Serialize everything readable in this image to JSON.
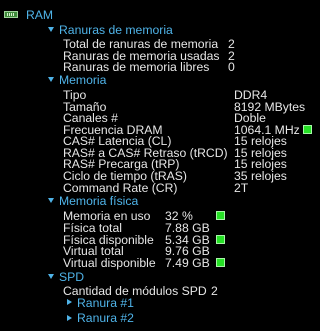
{
  "root": {
    "label": "RAM",
    "icon": "ram-chip-icon"
  },
  "sections": {
    "slots": {
      "title": "Ranuras de memoria",
      "rows": [
        {
          "label": "Total de ranuras de memoria",
          "value": "2"
        },
        {
          "label": "Ranuras de memoria usadas",
          "value": "2"
        },
        {
          "label": "Ranuras de memoria libres",
          "value": "0"
        }
      ]
    },
    "memory": {
      "title": "Memoria",
      "rows": [
        {
          "label": "Tipo",
          "value": "DDR4"
        },
        {
          "label": "Tamaño",
          "value": "8192 MBytes"
        },
        {
          "label": "Canales #",
          "value": "Doble"
        },
        {
          "label": "Frecuencia DRAM",
          "value": "1064.1 MHz"
        },
        {
          "label": "CAS# Latencia (CL)",
          "value": "15 relojes"
        },
        {
          "label": "RAS# a CAS# Retraso (tRCD)",
          "value": "15 relojes"
        },
        {
          "label": "RAS# Precarga (tRP)",
          "value": "15 relojes"
        },
        {
          "label": "Ciclo de tiempo (tRAS)",
          "value": "35 relojes"
        },
        {
          "label": "Command Rate (CR)",
          "value": "2T"
        }
      ]
    },
    "physical": {
      "title": "Memoria física",
      "rows": [
        {
          "label": "Memoria en uso",
          "value": "32 %"
        },
        {
          "label": "Física total",
          "value": "7.88 GB"
        },
        {
          "label": "Física disponible",
          "value": "5.34 GB"
        },
        {
          "label": "Virtual total",
          "value": "9.76 GB"
        },
        {
          "label": "Virtual disponible",
          "value": "7.49 GB"
        }
      ]
    },
    "spd": {
      "title": "SPD",
      "count_label": "Cantidad de módulos SPD",
      "count_value": "2",
      "slots": [
        "Ranura #1",
        "Ranura #2"
      ]
    }
  },
  "colors": {
    "accent": "#4fb3e8",
    "indicator": "#26e126",
    "background": "#000000",
    "text": "#e6e6e6"
  }
}
